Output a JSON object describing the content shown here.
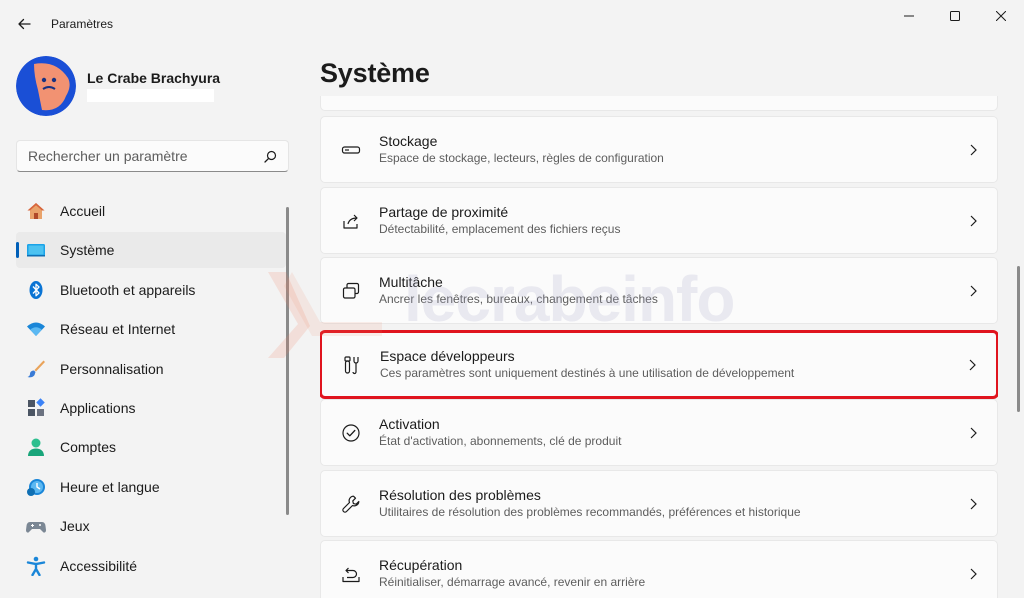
{
  "window": {
    "title": "Paramètres"
  },
  "profile": {
    "name": "Le Crabe Brachyura"
  },
  "search": {
    "placeholder": "Rechercher un paramètre"
  },
  "nav": {
    "items": [
      {
        "label": "Accueil",
        "icon": "home-icon"
      },
      {
        "label": "Système",
        "icon": "system-icon",
        "active": true
      },
      {
        "label": "Bluetooth et appareils",
        "icon": "bluetooth-icon"
      },
      {
        "label": "Réseau et Internet",
        "icon": "wifi-icon"
      },
      {
        "label": "Personnalisation",
        "icon": "brush-icon"
      },
      {
        "label": "Applications",
        "icon": "apps-icon"
      },
      {
        "label": "Comptes",
        "icon": "account-icon"
      },
      {
        "label": "Heure et langue",
        "icon": "time-language-icon"
      },
      {
        "label": "Jeux",
        "icon": "gamepad-icon"
      },
      {
        "label": "Accessibilité",
        "icon": "accessibility-icon"
      }
    ]
  },
  "main": {
    "title": "Système",
    "cards": [
      {
        "title": "Stockage",
        "subtitle": "Espace de stockage, lecteurs, règles de configuration",
        "icon": "storage-icon"
      },
      {
        "title": "Partage de proximité",
        "subtitle": "Détectabilité, emplacement des fichiers reçus",
        "icon": "share-icon"
      },
      {
        "title": "Multitâche",
        "subtitle": "Ancrer les fenêtres, bureaux, changement de tâches",
        "icon": "multitask-icon"
      },
      {
        "title": "Espace développeurs",
        "subtitle": "Ces paramètres sont uniquement destinés à une utilisation de développement",
        "icon": "developer-tools-icon",
        "highlighted": true
      },
      {
        "title": "Activation",
        "subtitle": "État d'activation, abonnements, clé de produit",
        "icon": "activation-icon"
      },
      {
        "title": "Résolution des problèmes",
        "subtitle": "Utilitaires de résolution des problèmes recommandés, préférences et historique",
        "icon": "wrench-icon"
      },
      {
        "title": "Récupération",
        "subtitle": "Réinitialiser, démarrage avancé, revenir en arrière",
        "icon": "recovery-icon"
      }
    ]
  },
  "watermark": {
    "text": "lecrabeinfo"
  },
  "colors": {
    "accent": "#005fb8",
    "highlight": "#e0141e",
    "background": "#f3f3f3",
    "card": "#fbfbfb"
  }
}
